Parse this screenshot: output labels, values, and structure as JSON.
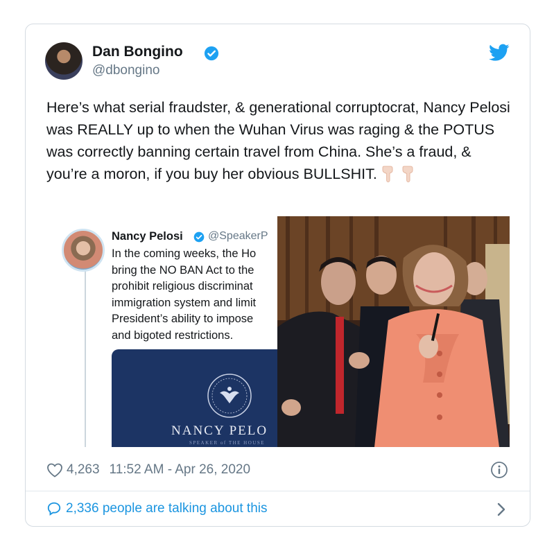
{
  "tweet": {
    "author_name": "Dan Bongino",
    "author_handle": "@dbongino",
    "text": "Here’s what serial fraudster, & generational corruptocrat, Nancy Pelosi was REALLY up to when the Wuhan Virus was raging & the POTUS was correctly banning certain travel from China. She’s a fraud, & you’re a moron, if you buy her obvious BULLSHIT.",
    "emojis": [
      "backhand-index-pointing-down",
      "backhand-index-pointing-down"
    ],
    "likes": "4,263",
    "timestamp": "11:52 AM - Apr 26, 2020",
    "talking": "2,336 people are talking about this"
  },
  "embedded_image": {
    "quoted_tweet": {
      "name": "Nancy Pelosi",
      "handle": "@SpeakerP",
      "lines": [
        "In the coming weeks, the Ho",
        "bring the NO BAN Act to the",
        "prohibit religious discriminat",
        "immigration system and limit",
        "President’s ability to impose",
        "and bigoted restrictions."
      ]
    },
    "press_card": {
      "name": "NANCY PELO",
      "subtitle": "SPEAKER of THE HOUSE"
    }
  },
  "colors": {
    "twitter_blue": "#1da1f2",
    "link_blue": "#1b95e0",
    "muted_gray": "#657786",
    "press_navy": "#1c3464"
  },
  "icons": [
    "verified-icon",
    "twitter-bird-icon",
    "heart-icon",
    "info-icon",
    "speech-bubble-icon",
    "chevron-right-icon"
  ]
}
